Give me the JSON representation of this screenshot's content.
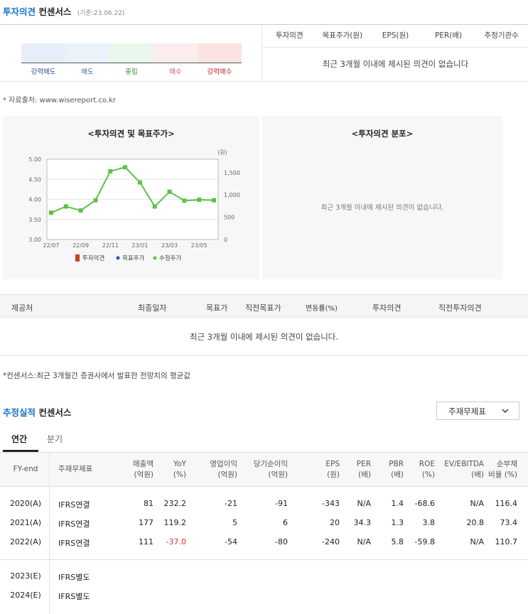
{
  "opinion": {
    "title_blue": "투자의견",
    "title_black": "컨센서스",
    "base_date": "(기준:23.06.22)",
    "scale_labels": [
      "강력매도",
      "매도",
      "중립",
      "매수",
      "강력매수"
    ],
    "scale_colors": [
      "#e8eef9",
      "#eaf3fb",
      "#eaf7ec",
      "#fcecec",
      "#fbe3e3"
    ],
    "label_colors": [
      "#2a4a8a",
      "#2a6fb8",
      "#2e8a3c",
      "#e05555",
      "#c0272d"
    ],
    "columns": [
      "투자의견",
      "목표주가(원)",
      "EPS(원)",
      "PER(배)",
      "추정기관수"
    ],
    "empty_msg": "최근 3개월 이내에 제시된 의견이 없습니다",
    "source": "* 자료출처: www.wisereport.co.kr"
  },
  "chart_panel": {
    "title": "<투자의견 및 목표주가>",
    "unit_right": "(원)",
    "legend": [
      "투자의견",
      "목표주가",
      "수정주가"
    ]
  },
  "chart_data": {
    "type": "line",
    "x": [
      "22/07",
      "22/08",
      "22/09",
      "22/10",
      "22/11",
      "22/12",
      "23/01",
      "23/02",
      "23/03",
      "23/04",
      "23/05",
      "23/06"
    ],
    "x_tick_labels": [
      "22/07",
      "22/09",
      "22/11",
      "23/01",
      "23/03",
      "23/05"
    ],
    "y_left_ticks": [
      "5.00",
      "4.50",
      "4.00",
      "3.50",
      "3.00"
    ],
    "y_left_lim": [
      3.0,
      5.0
    ],
    "y_right_ticks": [
      "1,500",
      "1,000",
      "500",
      "0"
    ],
    "y_right_lim": [
      0,
      1800
    ],
    "series": [
      {
        "name": "수정주가",
        "color": "#5cc247",
        "values": [
          600,
          740,
          650,
          880,
          1530,
          1620,
          1280,
          740,
          1070,
          870,
          890,
          880
        ]
      }
    ]
  },
  "dist_panel": {
    "title": "<투자의견 분포>",
    "empty_msg": "최근 3개월 이내에 제시된 의견이 없습니다."
  },
  "provider_table": {
    "columns": [
      "제공처",
      "최종일자",
      "목표가",
      "직전목표가",
      "변동률(%)",
      "투자의견",
      "직전투자의견"
    ],
    "empty_msg": "최근 3개월 이내에 제시된 의견이 없습니다.",
    "footnote": "*컨센서스:최근 3개월간 증권사에서 발표한 전망치의 평균값"
  },
  "estimates": {
    "title_blue": "추정실적",
    "title_black": "컨센서스",
    "dropdown_value": "주재무제표",
    "tabs": [
      "연간",
      "분기"
    ],
    "header": {
      "fy": "FY-end",
      "basis": "주재무제표",
      "cols": [
        [
          "매출액",
          "(억원)"
        ],
        [
          "YoY",
          "(%)"
        ],
        [
          "영업이익",
          "(억원)"
        ],
        [
          "당기순이익",
          "(억원)"
        ],
        [
          "EPS",
          "(원)"
        ],
        [
          "PER",
          "(배)"
        ],
        [
          "PBR",
          "(배)"
        ],
        [
          "ROE",
          "(%)"
        ],
        [
          "EV/EBITDA",
          "(배)"
        ],
        [
          "순부채",
          "비율 (%)"
        ]
      ]
    },
    "rows": [
      {
        "fy": "2020(A)",
        "basis": "IFRS연결",
        "vals": [
          "81",
          "232.2",
          "-21",
          "-91",
          "-343",
          "N/A",
          "1.4",
          "-68.6",
          "N/A",
          "116.4"
        ],
        "neg_yoy": false
      },
      {
        "fy": "2021(A)",
        "basis": "IFRS연결",
        "vals": [
          "177",
          "119.2",
          "5",
          "6",
          "20",
          "34.3",
          "1.3",
          "3.8",
          "20.8",
          "73.4"
        ],
        "neg_yoy": false
      },
      {
        "fy": "2022(A)",
        "basis": "IFRS연결",
        "vals": [
          "111",
          "-37.0",
          "-54",
          "-80",
          "-240",
          "N/A",
          "5.8",
          "-59.8",
          "N/A",
          "110.7"
        ],
        "neg_yoy": true
      },
      {
        "fy": "2023(E)",
        "basis": "IFRS별도",
        "vals": [
          "",
          "",
          "",
          "",
          "",
          "",
          "",
          "",
          "",
          ""
        ],
        "neg_yoy": false
      },
      {
        "fy": "2024(E)",
        "basis": "IFRS별도",
        "vals": [
          "",
          "",
          "",
          "",
          "",
          "",
          "",
          "",
          "",
          ""
        ],
        "neg_yoy": false
      }
    ]
  }
}
